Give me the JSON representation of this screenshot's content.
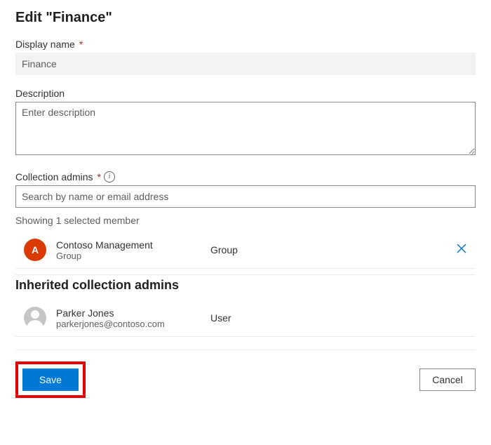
{
  "header": {
    "title": "Edit \"Finance\""
  },
  "displayName": {
    "label": "Display name",
    "value": "Finance"
  },
  "description": {
    "label": "Description",
    "placeholder": "Enter description",
    "value": ""
  },
  "admins": {
    "label": "Collection admins",
    "searchPlaceholder": "Search by name or email address",
    "hint": "Showing 1 selected member",
    "members": [
      {
        "avatarInitial": "A",
        "name": "Contoso Management",
        "subtitle": "Group",
        "type": "Group"
      }
    ]
  },
  "inherited": {
    "title": "Inherited collection admins",
    "members": [
      {
        "name": "Parker Jones",
        "subtitle": "parkerjones@contoso.com",
        "type": "User"
      }
    ]
  },
  "footer": {
    "save": "Save",
    "cancel": "Cancel"
  }
}
